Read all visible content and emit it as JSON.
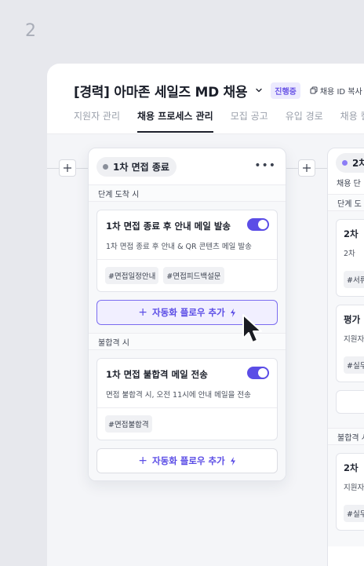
{
  "step_number": "2",
  "header": {
    "job_title": "[경력] 아마존 세일즈 MD 채용",
    "status": "진행중",
    "copy_id_label": "채용 ID 복사"
  },
  "tabs": [
    {
      "label": "지원자 관리",
      "active": false
    },
    {
      "label": "채용 프로세스 관리",
      "active": true
    },
    {
      "label": "모집 공고",
      "active": false
    },
    {
      "label": "유입 경로",
      "active": false
    },
    {
      "label": "채용 캘린더",
      "active": false
    }
  ],
  "stage1": {
    "name": "1차 면접 종료",
    "sections": [
      {
        "label": "단계 도착 시",
        "flow": {
          "title": "1차 면접 종료 후 안내 메일 발송",
          "description": "1차 면접 종료 후 안내 & QR 콘텐츠 메일 발송",
          "enabled": true,
          "tags": [
            "#면접일정안내",
            "#면접피드백설문"
          ]
        },
        "add_label": "자동화 플로우 추가"
      },
      {
        "label": "불합격 시",
        "flow": {
          "title": "1차 면접 불합격 메일 전송",
          "description": "면접 불합격 시, 오전 11시에 안내 메일을 전송",
          "enabled": true,
          "tags": [
            "#면접불합격"
          ]
        },
        "add_label": "자동화 플로우 추가"
      }
    ]
  },
  "stage2": {
    "name": "2차",
    "subtitle": "채용 단",
    "arrival_label": "단계 도",
    "cards": [
      {
        "title": "2차 ",
        "desc": "2차",
        "tag": "#서류"
      },
      {
        "title": "평가",
        "desc": "지원자",
        "tag": "#실무"
      }
    ],
    "reject_label": "불합격 시",
    "reject_card": {
      "title": "2차 ",
      "desc": "지원자",
      "tag": "#실무"
    }
  },
  "colors": {
    "accent": "#5b4de6",
    "background": "#e7e8ed"
  },
  "icons": {
    "chevron": "chevron-down-icon",
    "copy": "copy-icon",
    "more": "more-horizontal-icon",
    "plus": "plus-icon",
    "bolt": "lightning-bolt-icon",
    "cursor": "mouse-pointer-icon"
  }
}
